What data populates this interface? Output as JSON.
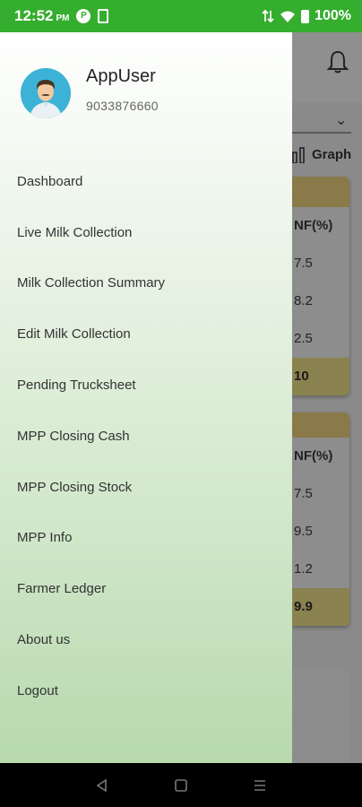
{
  "status_bar": {
    "time": "12:52",
    "ampm": "PM",
    "battery": "100%"
  },
  "user": {
    "name": "AppUser",
    "phone": "9033876660"
  },
  "menu": [
    {
      "label": "Dashboard"
    },
    {
      "label": "Live Milk Collection"
    },
    {
      "label": "Milk Collection Summary"
    },
    {
      "label": "Edit Milk Collection"
    },
    {
      "label": "Pending Trucksheet"
    },
    {
      "label": "MPP Closing Cash"
    },
    {
      "label": "MPP Closing Stock"
    },
    {
      "label": "MPP Info"
    },
    {
      "label": "Farmer Ledger"
    },
    {
      "label": "About us"
    },
    {
      "label": "Logout"
    }
  ],
  "background": {
    "graph_label": "Graph",
    "card1": {
      "header": "NF(%)",
      "rows": [
        "7.5",
        "8.2",
        "2.5"
      ],
      "footer": "10"
    },
    "card2": {
      "header": "NF(%)",
      "rows": [
        "7.5",
        "9.5",
        "1.2"
      ],
      "footer": "9.9"
    }
  },
  "colors": {
    "status_bar": "#35ad2e",
    "drawer_top": "#ffffff",
    "drawer_bottom": "#b7d9ad",
    "scrim": "#8a8a8a"
  }
}
